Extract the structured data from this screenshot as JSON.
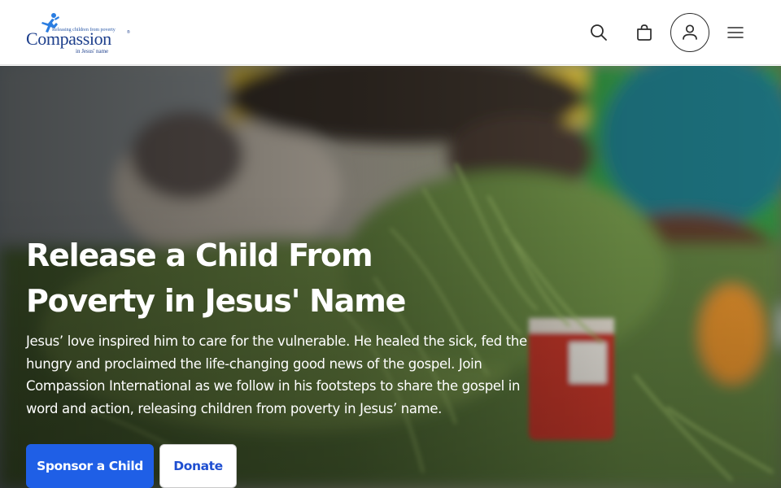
{
  "header": {
    "logo": {
      "wordmark": "Compassion",
      "tagline": "Releasing children from poverty",
      "subline": "in Jesus' name",
      "registered": "®"
    },
    "icons": [
      "search-icon",
      "bag-icon",
      "user-icon",
      "menu-icon"
    ]
  },
  "hero": {
    "title": "Release a Child From Poverty in Jesus' Name",
    "body": "Jesus’ love inspired him to care for the vulnerable. He healed the sick, fed the hungry and proclaimed the life-changing good news of the gospel. Join Compassion International as we follow in his footsteps to share the gospel in word and action, releasing children from poverty in Jesus’ name.",
    "primary_button": "Sponsor a Child",
    "secondary_button": "Donate"
  },
  "colors": {
    "brand_blue": "#1d3f8c",
    "primary_button": "#1f5fe6",
    "secondary_text": "#1f4fd1"
  }
}
